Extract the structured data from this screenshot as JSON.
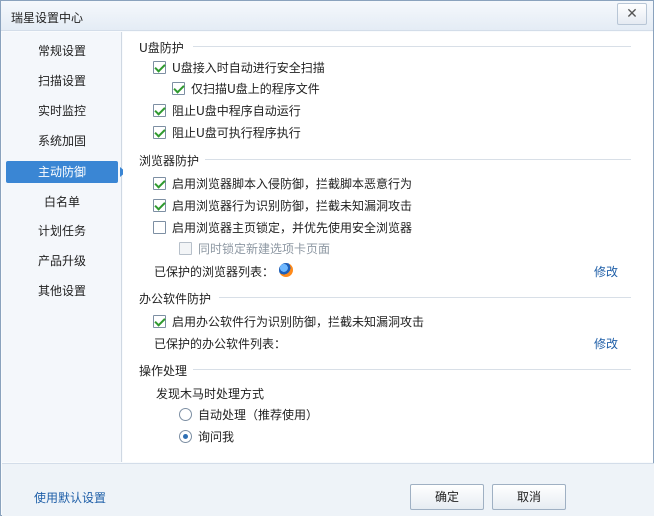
{
  "window": {
    "title": "瑞星设置中心",
    "close_glyph": "✕"
  },
  "sidebar": {
    "items": [
      {
        "label": "常规设置"
      },
      {
        "label": "扫描设置"
      },
      {
        "label": "实时监控"
      },
      {
        "label": "系统加固"
      },
      {
        "label": "主动防御",
        "active": true
      },
      {
        "label": "白名单"
      },
      {
        "label": "计划任务"
      },
      {
        "label": "产品升级"
      },
      {
        "label": "其他设置"
      }
    ]
  },
  "usb": {
    "title": "U盘防护",
    "options": [
      {
        "label": "U盘接入时自动进行安全扫描",
        "checked": true
      },
      {
        "label": "仅扫描U盘上的程序文件",
        "checked": true
      },
      {
        "label": "阻止U盘中程序自动运行",
        "checked": true
      },
      {
        "label": "阻止U盘可执行程序执行",
        "checked": true
      }
    ]
  },
  "browser": {
    "title": "浏览器防护",
    "options": [
      {
        "label": "启用浏览器脚本入侵防御，拦截脚本恶意行为",
        "checked": true
      },
      {
        "label": "启用浏览器行为识别防御，拦截未知漏洞攻击",
        "checked": true
      },
      {
        "label": "启用浏览器主页锁定，并优先使用安全浏览器",
        "checked": false
      },
      {
        "label": "同时锁定新建选项卡页面",
        "checked": false,
        "disabled": true
      }
    ],
    "protected_label": "已保护的浏览器列表：",
    "protected_icon": "firefox-icon",
    "modify_label": "修改"
  },
  "office": {
    "title": "办公软件防护",
    "options": [
      {
        "label": "启用办公软件行为识别防御，拦截未知漏洞攻击",
        "checked": true
      }
    ],
    "protected_label": "已保护的办公软件列表：",
    "modify_label": "修改"
  },
  "handling": {
    "title": "操作处理",
    "subtitle": "发现木马时处理方式",
    "options": [
      {
        "label": "自动处理（推荐使用）",
        "selected": false
      },
      {
        "label": "询问我",
        "selected": true
      }
    ]
  },
  "footer": {
    "default_label": "使用默认设置",
    "ok_label": "确定",
    "cancel_label": "取消"
  }
}
